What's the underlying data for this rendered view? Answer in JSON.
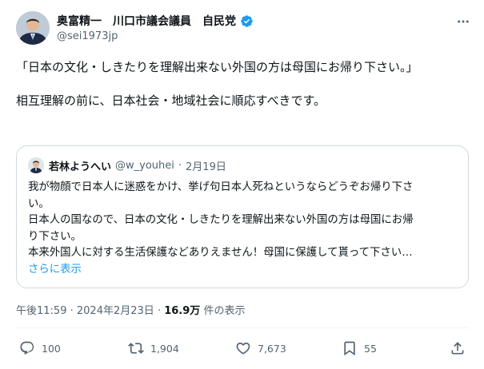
{
  "author": {
    "display_name": "奥富精一　川口市議会議員　自民党",
    "handle": "@sei1973jp"
  },
  "post": {
    "paragraphs": [
      "「日本の文化・しきたりを理解出来ない外国の方は母国にお帰り下さい。」",
      "相互理解の前に、日本社会・地域社会に順応すべきです。"
    ]
  },
  "quote": {
    "display_name": "若林ようへい",
    "handle": "@w_youhei",
    "separator": "·",
    "date": "2月19日",
    "lines": [
      "我が物顔で日本人に迷惑をかけ、挙げ句日本人死ねというならどうぞお帰り下さ",
      "い。",
      "日本人の国なので、日本の文化・しきたりを理解出来ない外国の方は母国にお帰",
      "り下さい。",
      "本来外国人に対する生活保護などありえません！母国に保護して貰って下さい…"
    ],
    "show_more": "さらに表示"
  },
  "meta": {
    "time": "午後11:59",
    "separator": "·",
    "date": "2024年2月23日",
    "views_count": "16.9万",
    "views_label": "件の表示"
  },
  "actions": {
    "replies": "100",
    "reposts": "1,904",
    "likes": "7,673",
    "bookmarks": "55"
  },
  "colors": {
    "accent": "#1d9bf0",
    "text": "#0f1419",
    "muted": "#536471",
    "border": "#cfd9de"
  },
  "icons": [
    "verified-badge-icon",
    "more-icon",
    "reply-icon",
    "repost-icon",
    "like-icon",
    "bookmark-icon",
    "share-icon"
  ]
}
